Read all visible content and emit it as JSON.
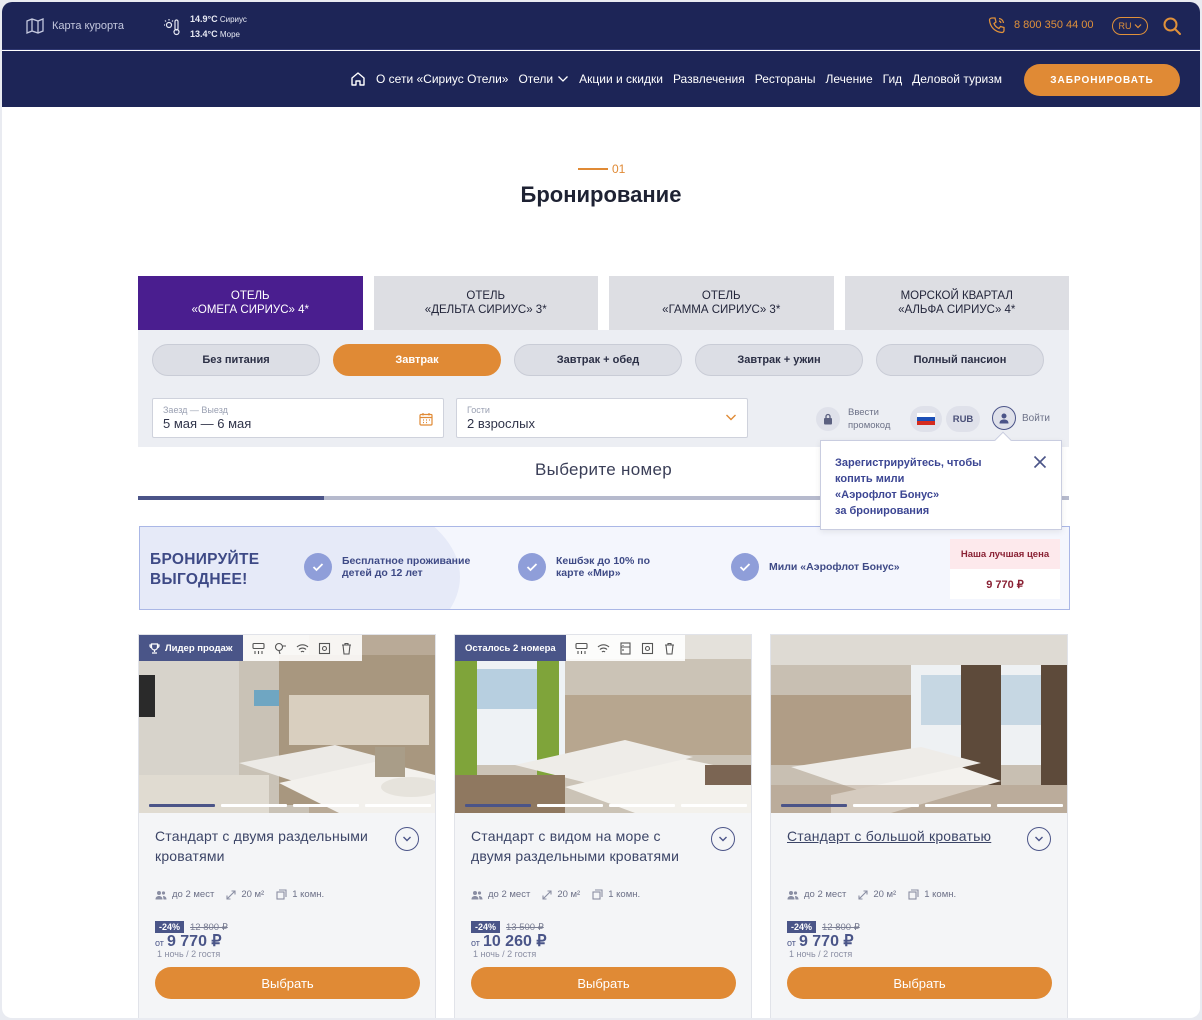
{
  "topbar": {
    "map_label": "Карта курорта",
    "weather": [
      {
        "temp": "14.9°C",
        "place": "Сириус"
      },
      {
        "temp": "13.4°C",
        "place": "Море"
      }
    ],
    "phone": "8 800 350 44 00",
    "lang": "RU"
  },
  "nav": {
    "items": [
      "О сети «Сириус Отели»",
      "Отели",
      "Акции и скидки",
      "Развлечения",
      "Рестораны",
      "Лечение",
      "Гид",
      "Деловой туризм"
    ],
    "book_label": "ЗАБРОНИРОВАТЬ"
  },
  "heading": {
    "step": "01",
    "title": "Бронирование"
  },
  "hotels": [
    {
      "line1": "ОТЕЛЬ",
      "line2": "«ОМЕГА СИРИУС» 4*"
    },
    {
      "line1": "ОТЕЛЬ",
      "line2": "«ДЕЛЬТА СИРИУС» 3*"
    },
    {
      "line1": "ОТЕЛЬ",
      "line2": "«ГАММА СИРИУС» 3*"
    },
    {
      "line1": "МОРСКОЙ КВАРТАЛ",
      "line2": "«АЛЬФА СИРИУС» 4*"
    }
  ],
  "meals": [
    "Без питания",
    "Завтрак",
    "Завтрак + обед",
    "Завтрак + ужин",
    "Полный пансион"
  ],
  "dates": {
    "label": "Заезд — Выезд",
    "value": "5 мая — 6 мая"
  },
  "guests": {
    "label": "Гости",
    "value": "2 взрослых"
  },
  "promo": {
    "line1": "Ввести",
    "line2": "промокод"
  },
  "currency": "RUB",
  "login_label": "Войти",
  "choose_room": "Выберите номер",
  "selection_progress": 0.2,
  "tooltip": {
    "text_lines": [
      "Зарегистрируйтесь, чтобы",
      "копить мили",
      "«Аэрофлот Бонус»",
      "за бронирования"
    ]
  },
  "benefits": {
    "heading_lines": [
      "БРОНИРУЙТЕ",
      "ВЫГОДНЕЕ!"
    ],
    "items": [
      {
        "line1": "Бесплатное проживание",
        "line2": "детей до 12 лет"
      },
      {
        "line1": "Кешбэк до 10% по",
        "line2": "карте «Мир»"
      },
      {
        "line1": "Мили «Аэрофлот Бонус»",
        "line2": ""
      }
    ],
    "best_price_label": "Наша лучшая цена",
    "best_price": "9 770 ₽"
  },
  "rooms": [
    {
      "tag": "Лидер продаж",
      "title": "Стандарт с двумя раздельными кроватями",
      "guests": "до 2 мест",
      "area": "20 м²",
      "rooms": "1 комн.",
      "discount": "-24%",
      "old_price": "12 800 ₽",
      "from": "от",
      "price": "9 770 ₽",
      "per": "1 ночь / 2 гостя",
      "button": "Выбрать"
    },
    {
      "tag": "Осталось 2 номера",
      "title": "Стандарт с видом на море с двумя раздельными кроватями",
      "guests": "до 2 мест",
      "area": "20 м²",
      "rooms": "1 комн.",
      "discount": "-24%",
      "old_price": "13 500 ₽",
      "from": "от",
      "price": "10 260 ₽",
      "per": "1 ночь / 2 гостя",
      "button": "Выбрать"
    },
    {
      "tag": "",
      "title": "Стандарт с большой кроватью",
      "guests": "до 2 мест",
      "area": "20 м²",
      "rooms": "1 комн.",
      "discount": "-24%",
      "old_price": "12 800 ₽",
      "from": "от",
      "price": "9 770 ₽",
      "per": "1 ночь / 2 гостя",
      "button": "Выбрать"
    }
  ],
  "colors": {
    "navy": "#1d2557",
    "accent": "#e08a35",
    "active_hotel": "#4a1e8f",
    "tag_blue": "#4a5588"
  }
}
